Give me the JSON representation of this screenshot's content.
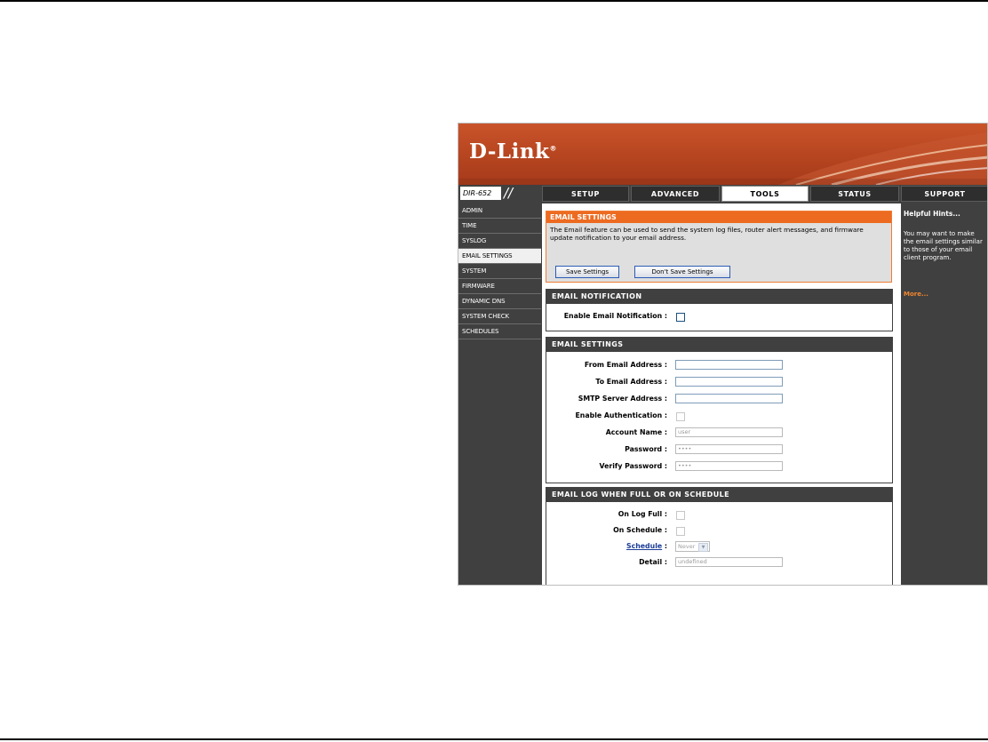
{
  "banner": {
    "logo": "D-Link",
    "logo_mark": "®"
  },
  "nav": {
    "model": "DIR-652",
    "slashes": "//",
    "tabs": [
      "SETUP",
      "ADVANCED",
      "TOOLS",
      "STATUS",
      "SUPPORT"
    ],
    "active_tab": "TOOLS"
  },
  "sidebar": {
    "items": [
      "ADMIN",
      "TIME",
      "SYSLOG",
      "EMAIL SETTINGS",
      "SYSTEM",
      "FIRMWARE",
      "DYNAMIC DNS",
      "SYSTEM CHECK",
      "SCHEDULES"
    ],
    "active": "EMAIL SETTINGS"
  },
  "intro": {
    "title": "EMAIL SETTINGS",
    "text": "The Email feature can be used to send the system log files, router alert messages, and firmware update notification to your email address.",
    "save_label": "Save Settings",
    "dont_save_label": "Don't Save Settings"
  },
  "notification": {
    "title": "EMAIL NOTIFICATION",
    "enable_label": "Enable Email Notification",
    "enable_checked": false
  },
  "email": {
    "title": "EMAIL SETTINGS",
    "from_label": "From Email Address",
    "from_value": "",
    "to_label": "To Email Address",
    "to_value": "",
    "smtp_label": "SMTP Server Address",
    "smtp_value": "",
    "auth_label": "Enable Authentication",
    "auth_checked": false,
    "account_label": "Account Name",
    "account_value": "user",
    "password_label": "Password",
    "password_value": "••••",
    "verify_label": "Verify Password",
    "verify_value": "••••"
  },
  "log": {
    "title": "EMAIL LOG WHEN FULL OR ON SCHEDULE",
    "log_full_label": "On Log Full",
    "log_full_checked": false,
    "on_schedule_label": "On Schedule",
    "on_schedule_checked": false,
    "schedule_label": "Schedule",
    "schedule_value": "Never",
    "detail_label": "Detail",
    "detail_value": "undefined"
  },
  "hints": {
    "title": "Helpful Hints...",
    "text": "You may want to make the email settings similar to those of your email client program.",
    "more": "More..."
  },
  "colon": ":",
  "colors": {
    "accent": "#ed6b21",
    "dark": "#404040",
    "link": "#1b3d96"
  }
}
